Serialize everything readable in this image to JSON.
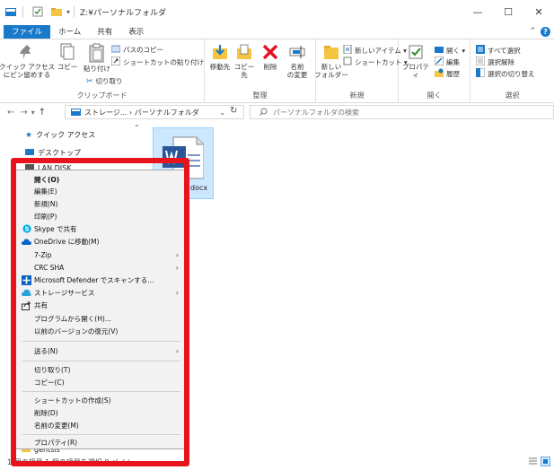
{
  "titlebar": {
    "title": "Z:¥パーソナルフォルダ",
    "min": "—",
    "max": "☐",
    "close": "✕"
  },
  "tabs": [
    "ファイル",
    "ホーム",
    "共有",
    "表示"
  ],
  "ribbon": {
    "clipboard": {
      "pin": "クイック アクセス\nにピン留めする",
      "copy": "コピー",
      "paste": "貼り付け",
      "copy_path": "パスのコピー",
      "paste_shortcut": "ショートカットの貼り付け",
      "cut": "切り取り",
      "label": "クリップボード"
    },
    "organize": {
      "move": "移動先",
      "copyto": "コピー先",
      "delete": "削除",
      "rename": "名前\nの変更",
      "label": "整理"
    },
    "new": {
      "new_folder": "新しい\nフォルダー",
      "new_item": "新しいアイテム ▾",
      "shortcut": "ショートカット ▾",
      "label": "新規"
    },
    "open": {
      "properties": "プロパティ",
      "open": "開く ▾",
      "edit": "編集",
      "history": "履歴",
      "label": "開く"
    },
    "select": {
      "all": "すべて選択",
      "none": "選択解除",
      "invert": "選択の切り替え",
      "label": "選択"
    }
  },
  "address": {
    "path": "ストレージ... › パーソナルフォルダ",
    "search_placeholder": "パーソナルフォルダの検索"
  },
  "navpane": {
    "quick_access": "クイック アクセス",
    "desktop": "デスクトップ",
    "landisk": "LAN DISK",
    "gentsis": "gentsis"
  },
  "content": {
    "file_ext": "docx"
  },
  "status": {
    "text": "1 個の項目    1 個の項目を選択  0 バイト"
  },
  "context_menu": {
    "items": [
      {
        "label": "開く(O)",
        "bold": true
      },
      {
        "label": "編集(E)"
      },
      {
        "label": "新規(N)"
      },
      {
        "label": "印刷(P)"
      },
      {
        "label": "Skype で共有",
        "icon": "skype-icon"
      },
      {
        "label": "OneDrive に移動(M)",
        "icon": "onedrive-icon"
      },
      {
        "label": "7-Zip",
        "submenu": true
      },
      {
        "label": "CRC SHA",
        "submenu": true
      },
      {
        "label": "Microsoft Defender でスキャンする...",
        "icon": "defender-icon"
      },
      {
        "label": "ストレージサービス",
        "icon": "storage-icon",
        "submenu": true
      },
      {
        "label": "共有",
        "icon": "share-icon"
      },
      {
        "label": "プログラムから開く(H)..."
      },
      {
        "label": "以前のバージョンの復元(V)"
      },
      {
        "label": "送る(N)",
        "submenu": true
      },
      {
        "label": "切り取り(T)"
      },
      {
        "label": "コピー(C)"
      },
      {
        "label": "ショートカットの作成(S)"
      },
      {
        "label": "削除(D)"
      },
      {
        "label": "名前の変更(M)"
      },
      {
        "label": "プロパティ(R)"
      }
    ]
  },
  "colors": {
    "accent": "#1979ca",
    "highlight": "#e8141b",
    "selection": "#cce8ff"
  }
}
